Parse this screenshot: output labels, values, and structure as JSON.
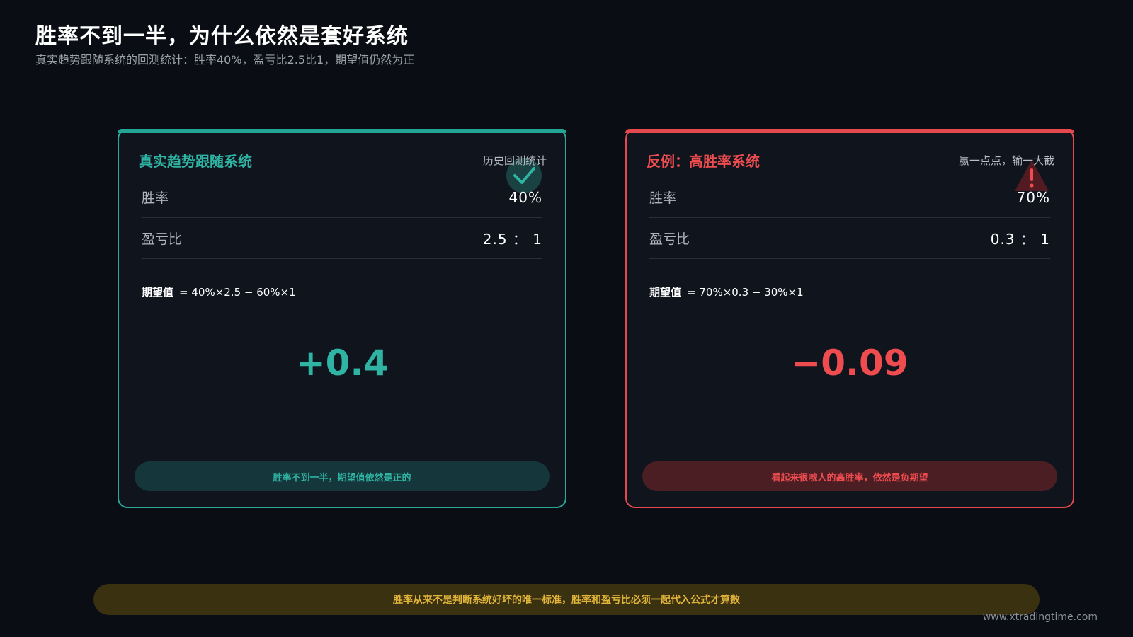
{
  "header": {
    "title": "胜率不到一半，为什么依然是套好系统",
    "subtitle": "真实趋势跟随系统的回测统计：胜率40%，盈亏比2.5比1，期望值仍然为正"
  },
  "cards": [
    {
      "title": "真实趋势跟随系统",
      "tag": "历史回测统计",
      "icon": "check-icon",
      "rows": [
        {
          "label": "胜率",
          "value": "40%"
        },
        {
          "label": "盈亏比",
          "value": "2.5 ： 1"
        }
      ],
      "formula_label": "期望值",
      "formula": "= 40%×2.5 − 60%×1",
      "result": "+0.4",
      "note": "胜率不到一半，期望值依然是正的",
      "accent": "#2fb3a3"
    },
    {
      "title": "反例：高胜率系统",
      "tag": "赢一点点，输一大截",
      "icon": "warning-icon",
      "rows": [
        {
          "label": "胜率",
          "value": "70%"
        },
        {
          "label": "盈亏比",
          "value": "0.3 ： 1"
        }
      ],
      "formula_label": "期望值",
      "formula": "= 70%×0.3 − 30%×1",
      "result": "−0.09",
      "note": "看起来很唬人的高胜率，依然是负期望",
      "accent": "#ef4c50"
    }
  ],
  "footer": {
    "bar_text": "胜率从来不是判断系统好坏的唯一标准，胜率和盈亏比必须一起代入公式才算数",
    "watermark": "www.xtradingtime.com",
    "bar_color": "#e2b53a"
  }
}
